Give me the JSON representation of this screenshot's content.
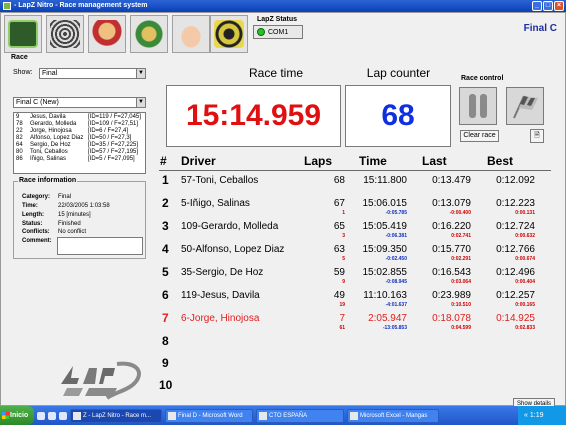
{
  "window": {
    "title": "- LapZ Nitro - Race management system"
  },
  "status": {
    "title": "LapZ Status",
    "port": "COM1"
  },
  "heat_title": "Final C",
  "race": {
    "section": "Race",
    "show_label": "Show:",
    "show_value": "Final",
    "heat_value": "Final C (New)",
    "entries": [
      {
        "num": "9",
        "name": "Jesus, Davila",
        "id": "[ID=119 / F=27,045]"
      },
      {
        "num": "78",
        "name": "Gerardo, Molleda",
        "id": "[ID=109 / F=27,51]"
      },
      {
        "num": "22",
        "name": "Jorge, Hinojosa",
        "id": "[ID=6 / F=27,4]"
      },
      {
        "num": "82",
        "name": "Alfonso, Lopez Diaz",
        "id": "[ID=50 / F=27,3]"
      },
      {
        "num": "64",
        "name": "Sergio, De Hoz",
        "id": "[ID=35 / F=27,225]"
      },
      {
        "num": "80",
        "name": "Toni, Ceballos",
        "id": "[ID=57 / F=27,195]"
      },
      {
        "num": "86",
        "name": "Iñigo, Salinas",
        "id": "[ID=5 / F=27,095]"
      }
    ]
  },
  "race_info": {
    "title": "Race information",
    "category_label": "Category:",
    "category": "Final",
    "time_label": "Time:",
    "time": "22/03/2005 1:03:58",
    "length_label": "Length:",
    "length": "15 [minutes]",
    "status_label": "Status:",
    "status": "Finished",
    "conflicts_label": "Conflicts:",
    "conflicts": "No conflict",
    "comment_label": "Comment:"
  },
  "race_time": {
    "label": "Race time",
    "value": "15:14.959"
  },
  "lap_counter": {
    "label": "Lap counter",
    "value": "68"
  },
  "race_control": {
    "title": "Race control",
    "clear_label": "Clear race"
  },
  "results": {
    "headers": {
      "pos": "#",
      "driver": "Driver",
      "laps": "Laps",
      "time": "Time",
      "last": "Last",
      "best": "Best"
    },
    "rows": [
      {
        "pos": "1",
        "driver": "57-Toni, Ceballos",
        "laps": "68",
        "laps_sub": "",
        "time": "15:11.800",
        "time_sub": "",
        "last": "0:13.479",
        "last_sub": "",
        "best": "0:12.092",
        "best_sub": ""
      },
      {
        "pos": "2",
        "driver": "5-Iñigo, Salinas",
        "laps": "67",
        "laps_sub": "1",
        "time": "15:06.015",
        "time_sub": "-0:05.785",
        "last": "0:13.079",
        "last_sub": "-0:00.400",
        "best": "0:12.223",
        "best_sub": "0:00.131"
      },
      {
        "pos": "3",
        "driver": "109-Gerardo, Molleda",
        "laps": "65",
        "laps_sub": "3",
        "time": "15:05.419",
        "time_sub": "-0:06.381",
        "last": "0:16.220",
        "last_sub": "0:02.741",
        "best": "0:12.724",
        "best_sub": "0:00.632"
      },
      {
        "pos": "4",
        "driver": "50-Alfonso, Lopez Diaz",
        "laps": "63",
        "laps_sub": "5",
        "time": "15:09.350",
        "time_sub": "-0:02.450",
        "last": "0:15.770",
        "last_sub": "0:02.291",
        "best": "0:12.766",
        "best_sub": "0:00.674"
      },
      {
        "pos": "5",
        "driver": "35-Sergio, De Hoz",
        "laps": "59",
        "laps_sub": "9",
        "time": "15:02.855",
        "time_sub": "-0:08.945",
        "last": "0:16.543",
        "last_sub": "0:03.064",
        "best": "0:12.496",
        "best_sub": "0:00.404"
      },
      {
        "pos": "6",
        "driver": "119-Jesus, Davila",
        "laps": "49",
        "laps_sub": "19",
        "time": "11:10.163",
        "time_sub": "-4:01.637",
        "last": "0:23.989",
        "last_sub": "0:10.510",
        "best": "0:12.257",
        "best_sub": "0:00.165"
      },
      {
        "pos": "7",
        "driver": "6-Jorge, Hinojosa",
        "laps": "7",
        "laps_sub": "61",
        "time": "2:05.947",
        "time_sub": "-13:05.853",
        "last": "0:18.078",
        "last_sub": "0:04.599",
        "best": "0:14.925",
        "best_sub": "0:02.833"
      },
      {
        "pos": "8"
      },
      {
        "pos": "9"
      },
      {
        "pos": "10"
      }
    ]
  },
  "show_details_label": "Show details",
  "taskbar": {
    "start_label": "Inicio",
    "tasks": [
      "Z - LapZ Nitro - Race m...",
      "Final D - Microsoft Word",
      "CTO ESPAÑA",
      "Microsoft Excel - Mangas"
    ],
    "clock": "1:19"
  }
}
